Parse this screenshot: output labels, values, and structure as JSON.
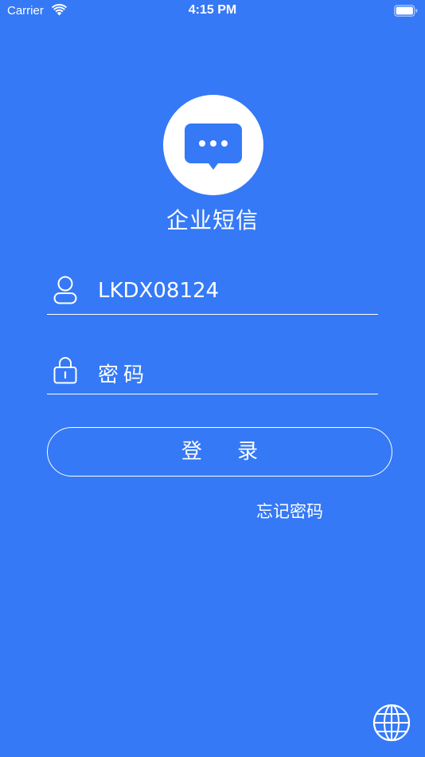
{
  "status_bar": {
    "carrier": "Carrier",
    "time": "4:15 PM"
  },
  "app": {
    "title": "企业短信",
    "logo_icon": "chat-bubble-icon"
  },
  "login_form": {
    "username_value": "LKDX08124",
    "password_placeholder": "密码",
    "login_label": "登 录",
    "forgot_password_label": "忘记密码"
  },
  "colors": {
    "background": "#3579F6",
    "foreground": "#FFFFFF"
  },
  "icons": {
    "user": "user-icon",
    "lock": "lock-icon",
    "language": "globe-icon"
  }
}
